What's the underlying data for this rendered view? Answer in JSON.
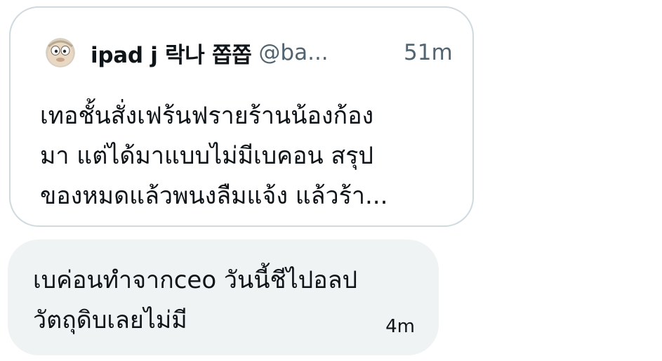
{
  "quote": {
    "author_name": "ipad j 락나 쫍쫍",
    "author_handle": "@ba...",
    "time": "51m",
    "avatar_icon": "avatar-cartoon-face-icon",
    "text_lines": [
      "เทอชั้นสั่งเฟร้นฟรายร้านน้องก้อง",
      "มา แต่ได้มาแบบไม่มีเบคอน สรุป",
      "ของหมดแล้วพนงลืมแจ้ง แล้วร้า..."
    ]
  },
  "message": {
    "text_lines": [
      "เบค่อนทำจากceo วันนี้ชีไปอลป",
      "วัตถุดิบเลยไม่มี"
    ],
    "time": "4m"
  },
  "colors": {
    "card_border": "#cfd9de",
    "bubble_bg": "#eff3f4",
    "primary_text": "#0f1419",
    "secondary_text": "#536471"
  }
}
